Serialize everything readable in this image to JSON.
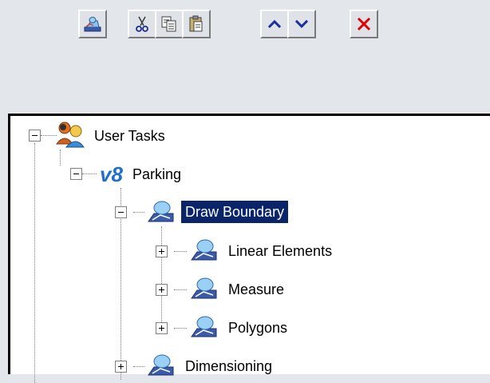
{
  "toolbar": {
    "buttons": [
      {
        "name": "properties",
        "icon": "task-properties-icon"
      },
      {
        "name": "cut",
        "icon": "scissors-icon"
      },
      {
        "name": "copy",
        "icon": "copy-icon"
      },
      {
        "name": "paste",
        "icon": "paste-icon"
      },
      {
        "name": "move-up",
        "icon": "chevron-up-icon"
      },
      {
        "name": "move-down",
        "icon": "chevron-down-icon"
      },
      {
        "name": "delete",
        "icon": "close-icon"
      }
    ]
  },
  "tree": {
    "root": {
      "label": "User Tasks",
      "icon": "users-icon",
      "expanded": true
    },
    "parking": {
      "label": "Parking",
      "icon": "v8-logo-icon",
      "expanded": true
    },
    "draw_boundary": {
      "label": "Draw Boundary",
      "icon": "task-icon",
      "expanded": true,
      "selected": true
    },
    "linear_elements": {
      "label": "Linear Elements",
      "icon": "task-icon",
      "expanded": false
    },
    "measure": {
      "label": "Measure",
      "icon": "task-icon",
      "expanded": false
    },
    "polygons": {
      "label": "Polygons",
      "icon": "task-icon",
      "expanded": false
    },
    "dimensioning": {
      "label": "Dimensioning",
      "icon": "task-icon",
      "expanded": false
    }
  },
  "colors": {
    "background": "#e3e6eb",
    "selection": "#0a246a",
    "chevron": "#1a2fa0",
    "delete": "#e00000"
  }
}
